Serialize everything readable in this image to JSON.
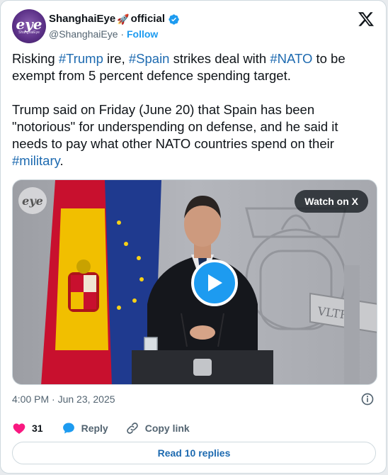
{
  "author": {
    "display_name": "ShanghaiEye",
    "name_suffix": "official",
    "emoji": "🚀",
    "handle": "@ShanghaiEye",
    "separator": "·",
    "follow_label": "Follow",
    "avatar_text": "eye",
    "avatar_subtext": "ShanghaiEye"
  },
  "post": {
    "p1": {
      "pre": "Risking ",
      "tag1": "#Trump",
      "mid1": " ire, ",
      "tag2": "#Spain",
      "mid2": " strikes deal with ",
      "tag3": "#NATO",
      "post": " to be exempt from 5 percent defence spending target."
    },
    "p2": {
      "text": "Trump said on Friday (June 20) that Spain has been \"notorious\" for underspending on defense, and he said it needs to pay what other NATO countries spend on their ",
      "tag": "#military",
      "end": "."
    }
  },
  "media": {
    "watch_label": "Watch on X",
    "watermark": "eye",
    "banner_text": "VLTRA"
  },
  "meta": {
    "timestamp": "4:00 PM · Jun 23, 2025"
  },
  "actions": {
    "like_count": "31",
    "reply_label": "Reply",
    "copy_label": "Copy link",
    "read_replies": "Read 10 replies"
  },
  "colors": {
    "accent": "#1d9bf0",
    "hashtag": "#1d6ab0",
    "like": "#f91880",
    "muted": "#536471"
  }
}
